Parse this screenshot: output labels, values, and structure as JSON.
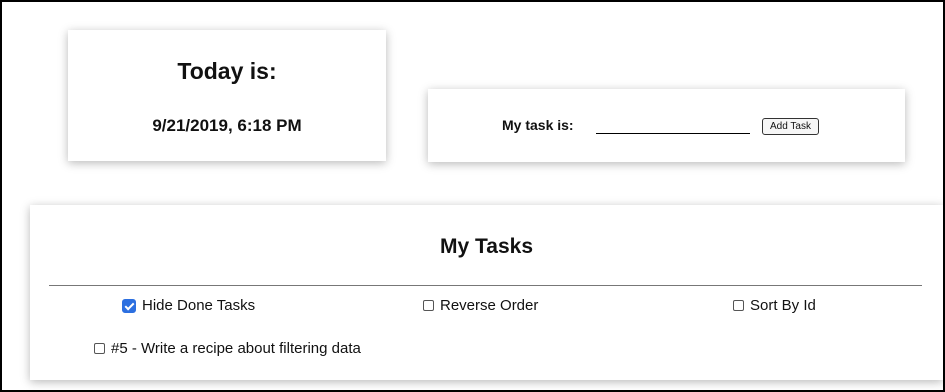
{
  "today": {
    "title": "Today is:",
    "datetime": "9/21/2019, 6:18 PM"
  },
  "task_form": {
    "label": "My task is:",
    "input_value": "",
    "add_button": "Add Task"
  },
  "tasks_panel": {
    "title": "My Tasks",
    "options": [
      {
        "label": "Hide Done Tasks",
        "checked": true
      },
      {
        "label": "Reverse Order",
        "checked": false
      },
      {
        "label": "Sort By Id",
        "checked": false
      }
    ],
    "tasks": [
      {
        "label": "#5 - Write a recipe about filtering data",
        "checked": false
      }
    ]
  },
  "colors": {
    "checkbox_checked": "#2c6fe0"
  }
}
